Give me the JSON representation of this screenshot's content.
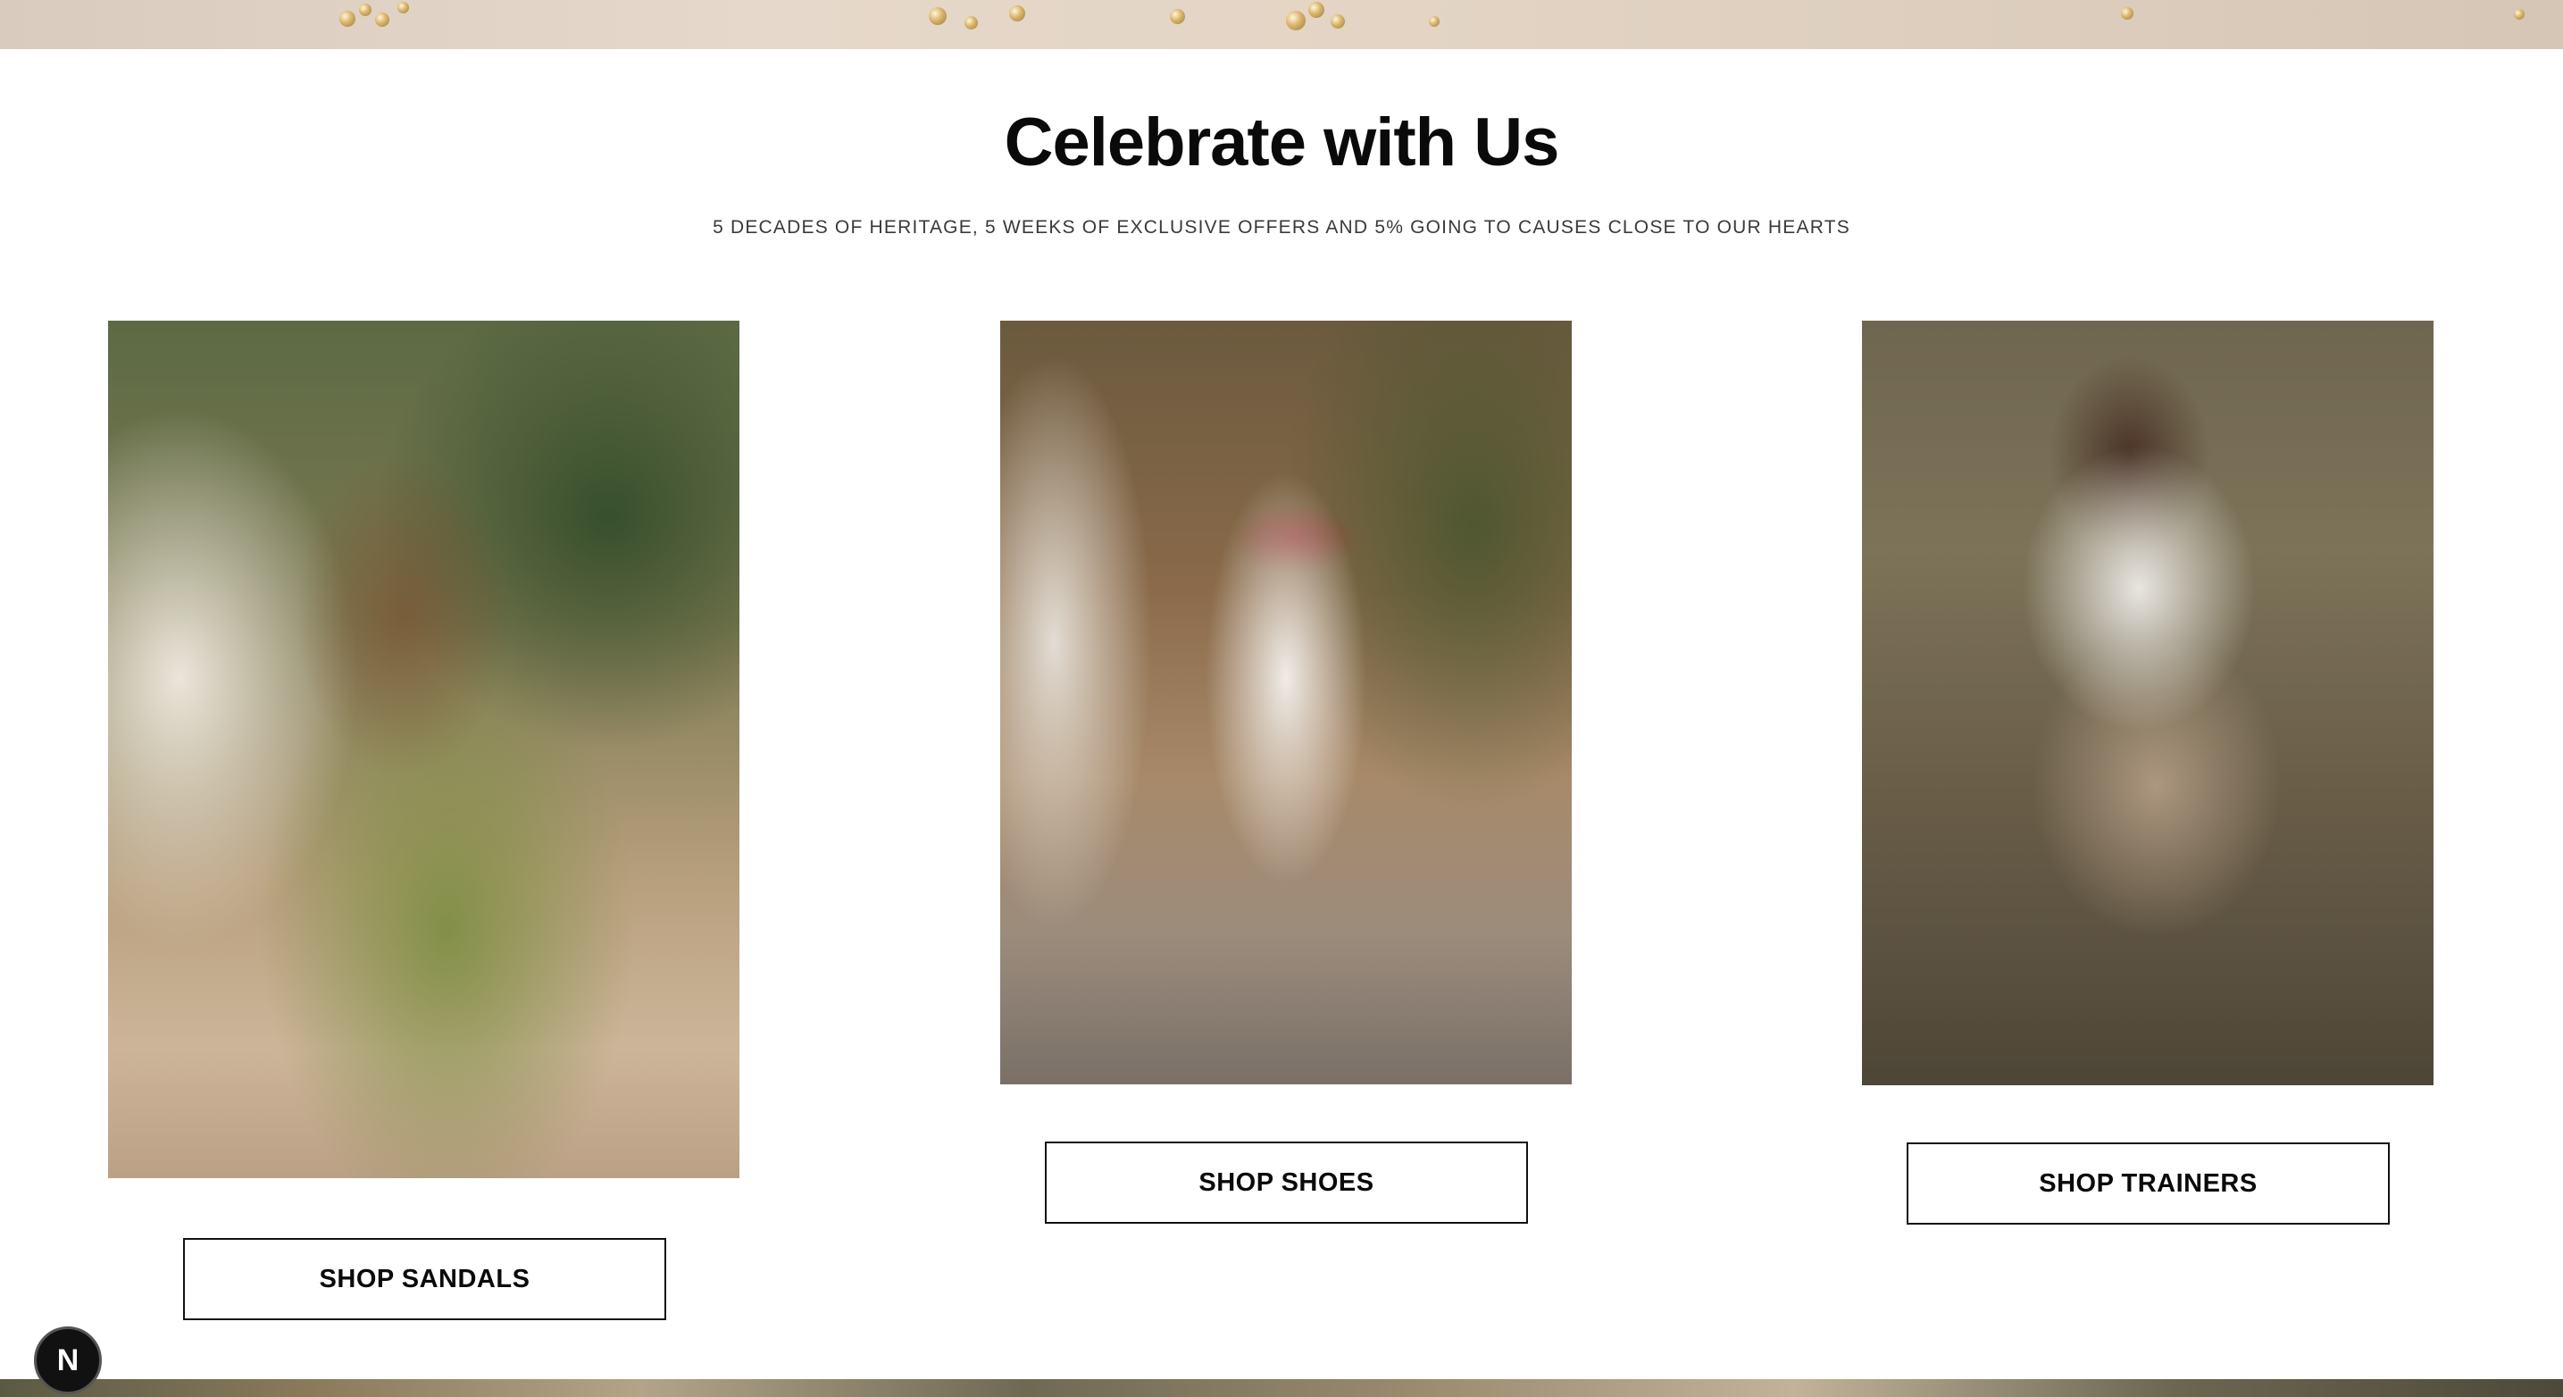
{
  "section": {
    "title": "Celebrate with Us",
    "subtitle": "5 DECADES OF HERITAGE, 5 WEEKS OF EXCLUSIVE OFFERS AND 5% GOING TO CAUSES CLOSE TO OUR HEARTS"
  },
  "cards": [
    {
      "image_alt": "Model in green dress seated wearing silver sandals",
      "cta_label": "SHOP SANDALS"
    },
    {
      "image_alt": "Model in white dress standing wearing metallic heels",
      "cta_label": "SHOP SHOES"
    },
    {
      "image_alt": "Model in white shirt seated in tall grass wearing trainers",
      "cta_label": "SHOP TRAINERS"
    }
  ],
  "badge": {
    "letter": "N",
    "icon": "n-logo-icon"
  }
}
